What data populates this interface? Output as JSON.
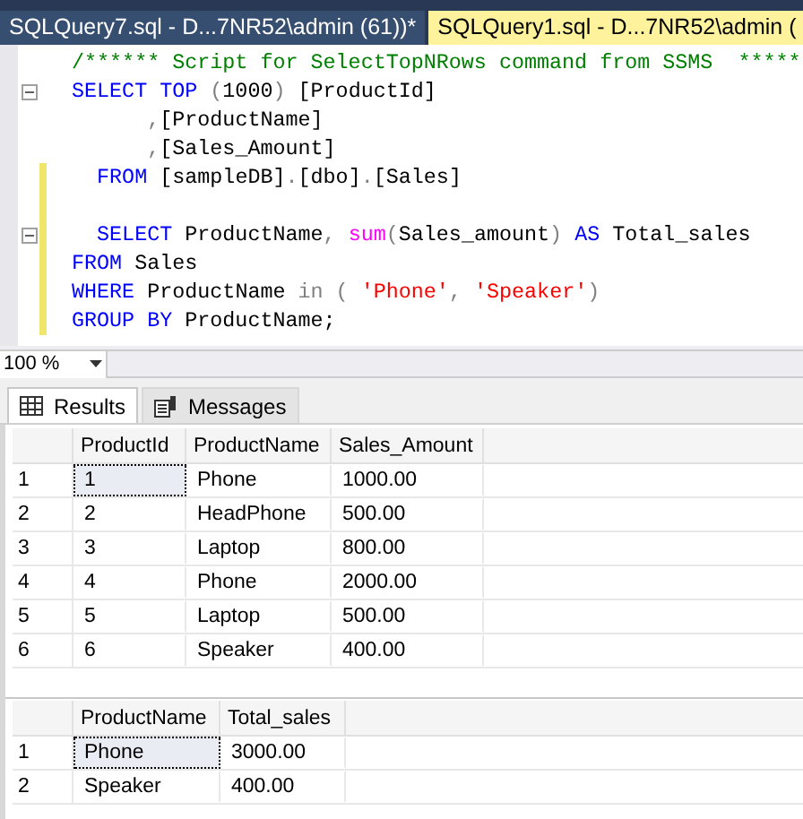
{
  "tabs": [
    {
      "label": "SQLQuery7.sql - D...7NR52\\admin (61))*",
      "selected": false
    },
    {
      "label": "SQLQuery1.sql - D...7NR52\\admin (",
      "selected": true
    }
  ],
  "editor": {
    "lines": [
      {
        "fold": false,
        "modified": false,
        "tokens": [
          {
            "kind": "comment",
            "text": "/****** Script for SelectTopNRows command from SSMS  *****"
          }
        ]
      },
      {
        "fold": true,
        "modified": false,
        "tokens": [
          {
            "kind": "keyword",
            "text": "SELECT TOP "
          },
          {
            "kind": "gray",
            "text": "("
          },
          {
            "kind": "plain",
            "text": "1000"
          },
          {
            "kind": "gray",
            "text": ")"
          },
          {
            "kind": "plain",
            "text": " [ProductId]"
          }
        ]
      },
      {
        "fold": false,
        "modified": false,
        "tokens": [
          {
            "kind": "gray",
            "text": "      ,"
          },
          {
            "kind": "plain",
            "text": "[ProductName]"
          }
        ]
      },
      {
        "fold": false,
        "modified": false,
        "tokens": [
          {
            "kind": "gray",
            "text": "      ,"
          },
          {
            "kind": "plain",
            "text": "[Sales_Amount]"
          }
        ]
      },
      {
        "fold": false,
        "modified": true,
        "tokens": [
          {
            "kind": "keyword",
            "text": "  FROM "
          },
          {
            "kind": "plain",
            "text": "[sampleDB]"
          },
          {
            "kind": "gray",
            "text": "."
          },
          {
            "kind": "plain",
            "text": "[dbo]"
          },
          {
            "kind": "gray",
            "text": "."
          },
          {
            "kind": "plain",
            "text": "[Sales]"
          }
        ]
      },
      {
        "fold": false,
        "modified": true
      },
      {
        "fold": true,
        "modified": true,
        "tokens": [
          {
            "kind": "keyword",
            "text": "  SELECT "
          },
          {
            "kind": "plain",
            "text": "ProductName"
          },
          {
            "kind": "gray",
            "text": ", "
          },
          {
            "kind": "func",
            "text": "sum"
          },
          {
            "kind": "gray",
            "text": "("
          },
          {
            "kind": "plain",
            "text": "Sales_amount"
          },
          {
            "kind": "gray",
            "text": ") "
          },
          {
            "kind": "keyword",
            "text": "AS "
          },
          {
            "kind": "plain",
            "text": "Total_sales"
          }
        ]
      },
      {
        "fold": false,
        "modified": true,
        "tokens": [
          {
            "kind": "keyword",
            "text": "FROM "
          },
          {
            "kind": "plain",
            "text": "Sales"
          }
        ]
      },
      {
        "fold": false,
        "modified": true,
        "tokens": [
          {
            "kind": "keyword",
            "text": "WHERE "
          },
          {
            "kind": "plain",
            "text": "ProductName "
          },
          {
            "kind": "gray",
            "text": "in ( "
          },
          {
            "kind": "string",
            "text": "'Phone'"
          },
          {
            "kind": "gray",
            "text": ", "
          },
          {
            "kind": "string",
            "text": "'Speaker'"
          },
          {
            "kind": "gray",
            "text": ")"
          }
        ]
      },
      {
        "fold": false,
        "modified": true,
        "tokens": [
          {
            "kind": "keyword",
            "text": "GROUP BY "
          },
          {
            "kind": "plain",
            "text": "ProductName;"
          }
        ]
      }
    ]
  },
  "zoom": {
    "value": "100 %"
  },
  "result_tabs": [
    {
      "label": "Results",
      "selected": true
    },
    {
      "label": "Messages",
      "selected": false
    }
  ],
  "grids": [
    {
      "columns": [
        "ProductId",
        "ProductName",
        "Sales_Amount"
      ],
      "rows": [
        {
          "number": "1",
          "cells": [
            "1",
            "Phone",
            "1000.00"
          ],
          "selected": true
        },
        {
          "number": "2",
          "cells": [
            "2",
            "HeadPhone",
            "500.00"
          ],
          "selected": false
        },
        {
          "number": "3",
          "cells": [
            "3",
            "Laptop",
            "800.00"
          ],
          "selected": false
        },
        {
          "number": "4",
          "cells": [
            "4",
            "Phone",
            "2000.00"
          ],
          "selected": false
        },
        {
          "number": "5",
          "cells": [
            "5",
            "Laptop",
            "500.00"
          ],
          "selected": false
        },
        {
          "number": "6",
          "cells": [
            "6",
            "Speaker",
            "400.00"
          ],
          "selected": false
        }
      ]
    },
    {
      "columns": [
        "ProductName",
        "Total_sales"
      ],
      "rows": [
        {
          "number": "1",
          "cells": [
            "Phone",
            "3000.00"
          ],
          "selected": true
        },
        {
          "number": "2",
          "cells": [
            "Speaker",
            "400.00"
          ],
          "selected": false
        }
      ]
    }
  ]
}
